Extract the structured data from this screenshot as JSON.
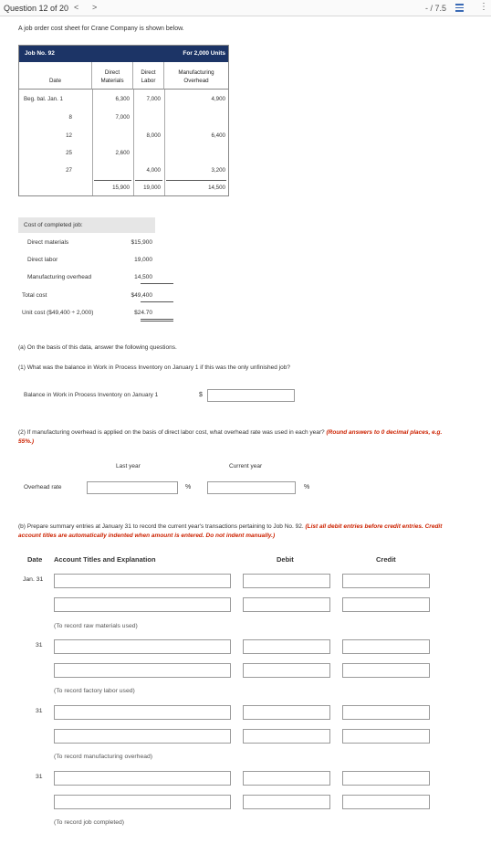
{
  "header": {
    "question_label": "Question 12 of 20",
    "prev_glyph": "<",
    "next_glyph": ">",
    "score": "- / 7.5"
  },
  "intro": "A job order cost sheet for Crane Company is shown below.",
  "job_sheet": {
    "job_no": "Job No. 92",
    "units": "For 2,000 Units",
    "col_date": "Date",
    "col_dm_1": "Direct",
    "col_dm_2": "Materials",
    "col_dl_1": "Direct",
    "col_dl_2": "Labor",
    "col_moh_1": "Manufacturing",
    "col_moh_2": "Overhead",
    "rows": [
      {
        "date": "Beg. bal. Jan. 1",
        "dm": "6,300",
        "dl": "7,000",
        "moh": "4,900"
      },
      {
        "date": "8",
        "dm": "7,000",
        "dl": "",
        "moh": ""
      },
      {
        "date": "12",
        "dm": "",
        "dl": "8,000",
        "moh": "6,400"
      },
      {
        "date": "25",
        "dm": "2,600",
        "dl": "",
        "moh": ""
      },
      {
        "date": "27",
        "dm": "",
        "dl": "4,000",
        "moh": "3,200"
      }
    ],
    "totals": {
      "dm": "15,900",
      "dl": "19,000",
      "moh": "14,500"
    }
  },
  "cost_completed": {
    "title": "Cost of completed job:",
    "dm_label": "Direct materials",
    "dm_value": "$15,900",
    "dl_label": "Direct labor",
    "dl_value": "19,000",
    "moh_label": "Manufacturing overhead",
    "moh_value": "14,500",
    "total_label": "Total cost",
    "total_value": "$49,400",
    "unit_label": "Unit cost ($49,400 ÷ 2,000)",
    "unit_value": "$24.70"
  },
  "part_a": {
    "intro": "(a) On the basis of this data, answer the following questions.",
    "q1": "(1) What was the balance in Work in Process Inventory on January 1 if this was the only unfinished job?",
    "balance_label": "Balance in Work in Process Inventory on January 1",
    "dollar": "$",
    "balance_value": "",
    "q2": "(2) If manufacturing overhead is applied on the basis of direct labor cost, what overhead rate was used in each year?",
    "q2_note": "(Round answers to 0 decimal places, e.g. 55%.)",
    "last_year": "Last year",
    "current_year": "Current year",
    "overhead_rate_label": "Overhead rate",
    "pct": "%",
    "last_year_value": "",
    "current_year_value": ""
  },
  "part_b": {
    "intro": "(b) Prepare summary entries at January 31 to record the current year's transactions pertaining to Job No. 92.",
    "note": "(List all debit entries before credit entries. Credit account titles are automatically indented when amount is entered. Do not indent manually.)",
    "col_date": "Date",
    "col_account": "Account Titles and Explanation",
    "col_debit": "Debit",
    "col_credit": "Credit",
    "entries": [
      {
        "date": "Jan. 31",
        "note": "(To record raw materials used)"
      },
      {
        "date": "31",
        "note": "(To record factory labor used)"
      },
      {
        "date": "31",
        "note": "(To record manufacturing overhead)"
      },
      {
        "date": "31",
        "note": "(To record job completed)"
      }
    ]
  },
  "colors": {
    "header_navy": "#1c3466",
    "note_red": "#cc2200",
    "cost_header_bg": "#e6e6e6"
  }
}
